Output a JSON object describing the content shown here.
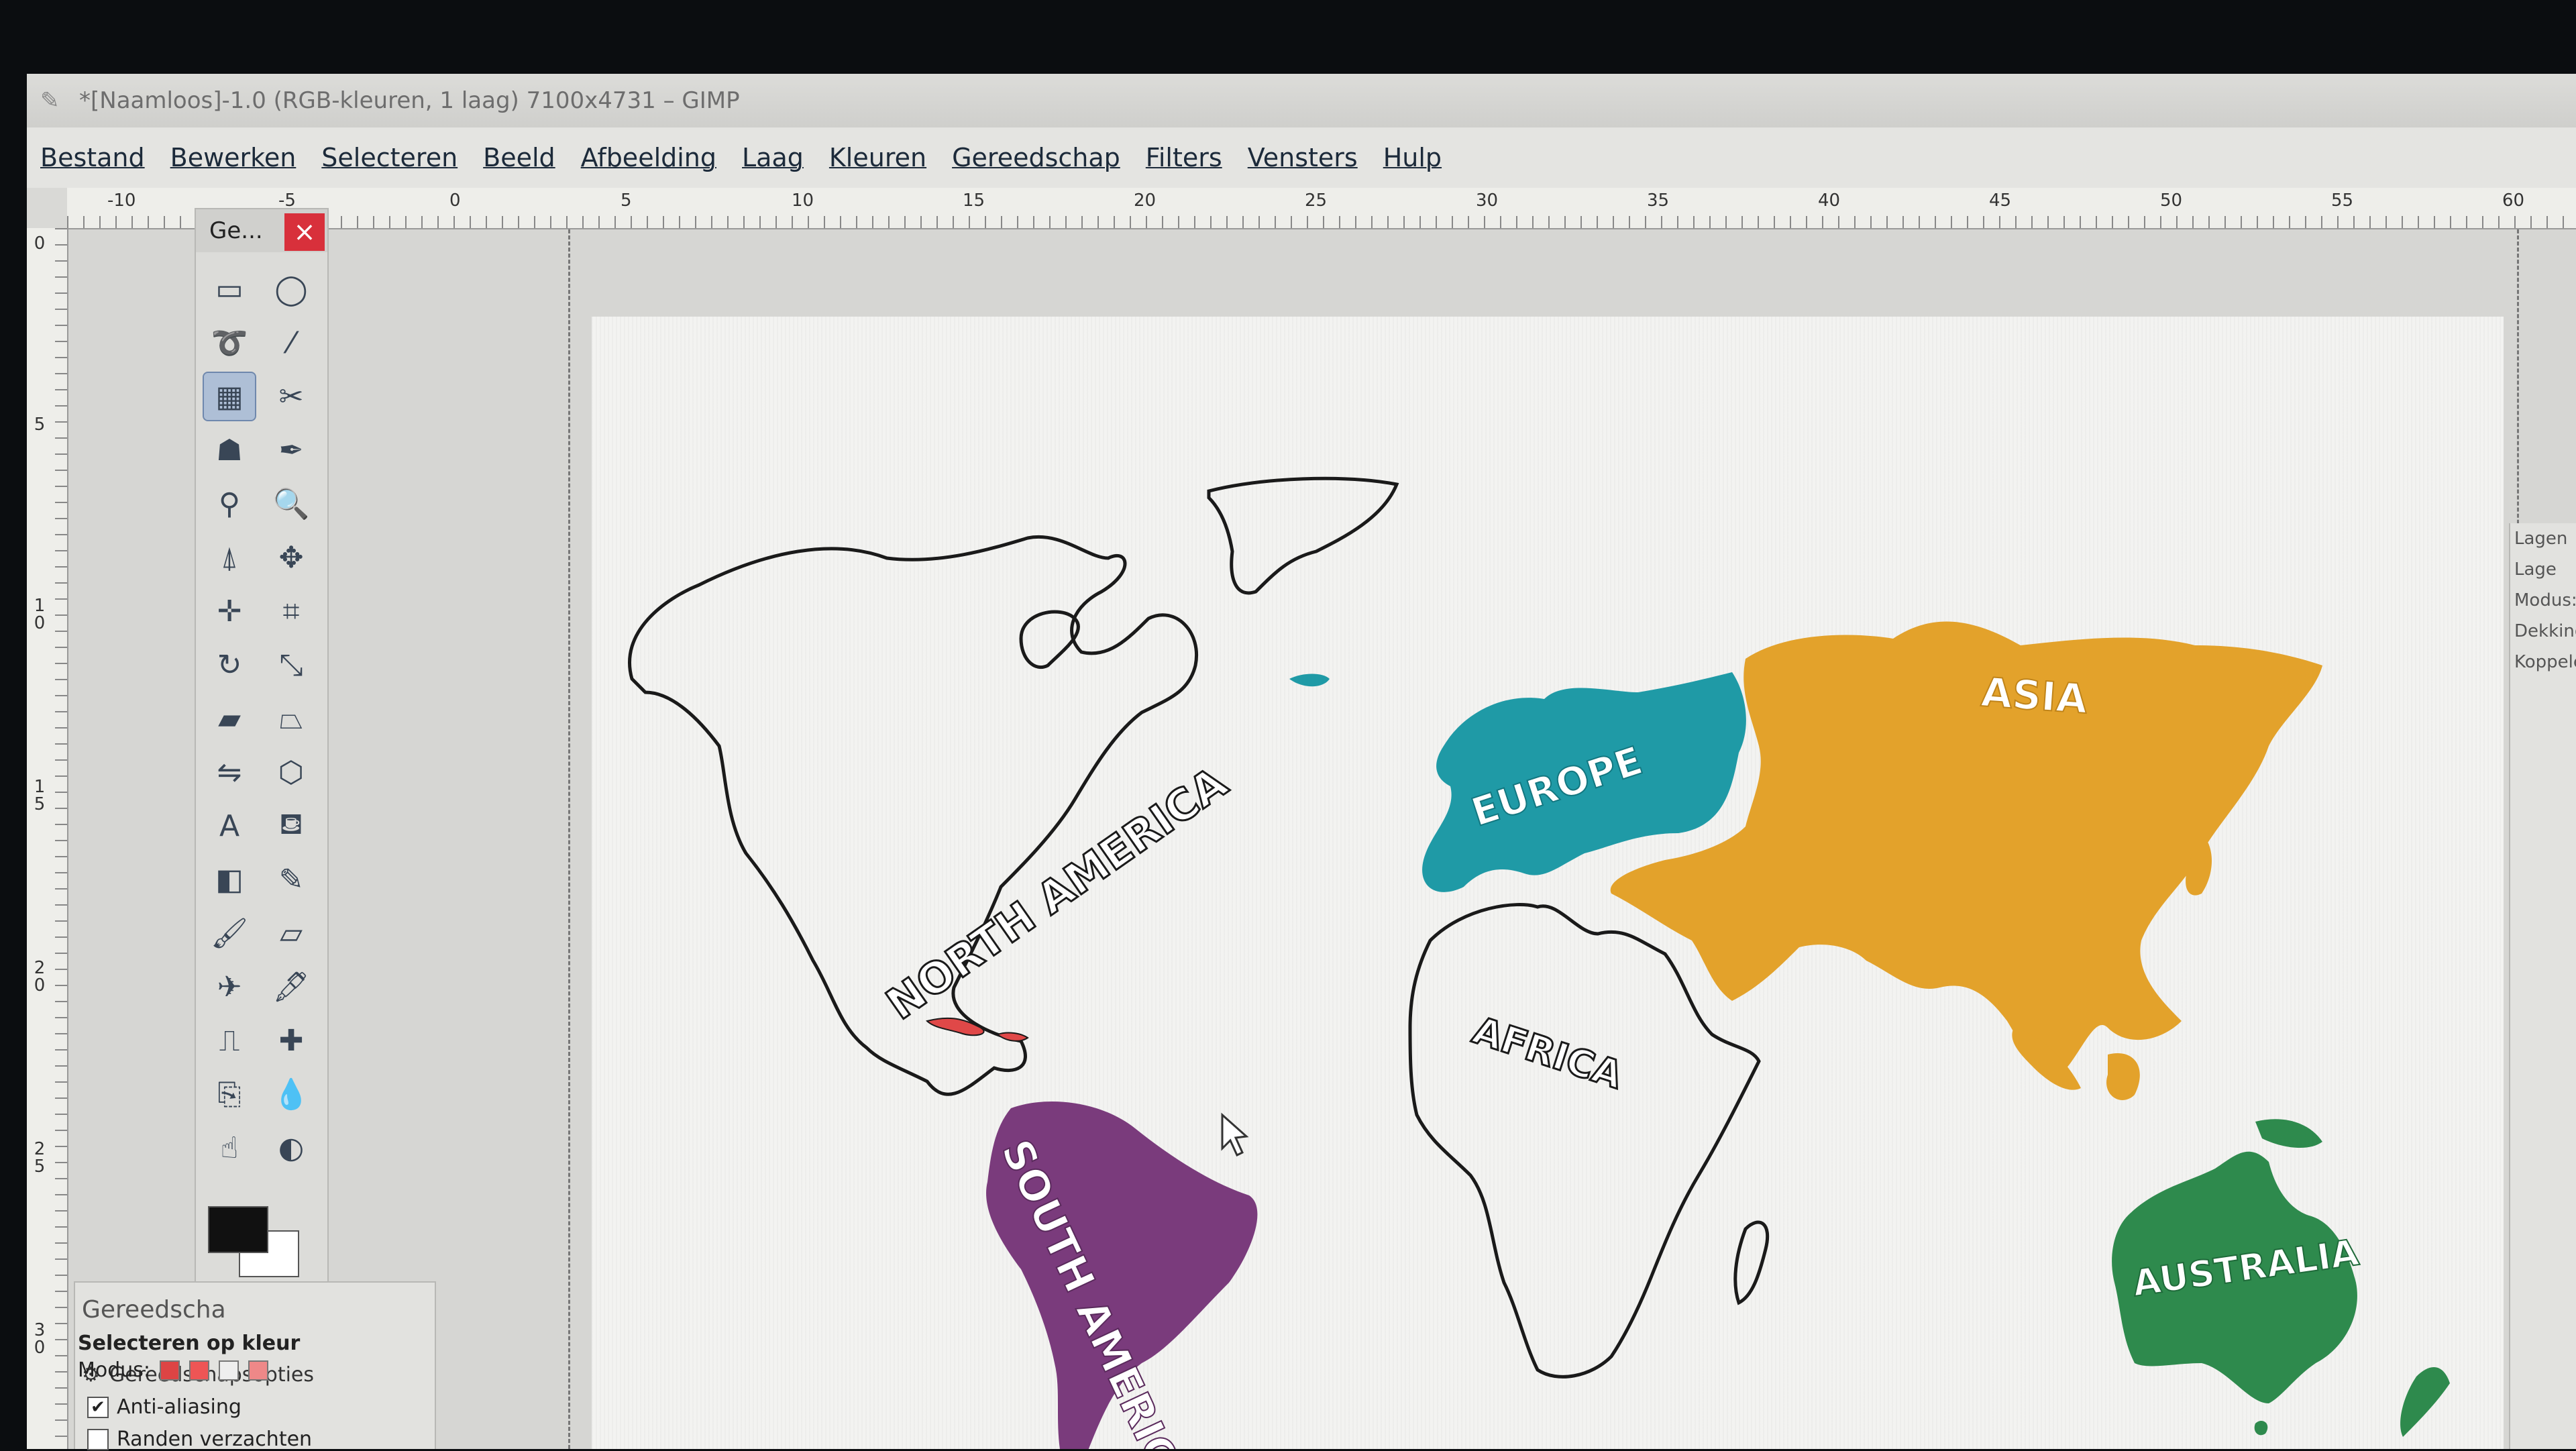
{
  "window": {
    "title": "*[Naamloos]-1.0 (RGB-kleuren, 1 laag) 7100x4731 – GIMP"
  },
  "menubar": {
    "items": [
      "Bestand",
      "Bewerken",
      "Selecteren",
      "Beeld",
      "Afbeelding",
      "Laag",
      "Kleuren",
      "Gereedschap",
      "Filters",
      "Vensters",
      "Hulp"
    ]
  },
  "ruler_top": [
    "-10",
    "-5",
    "0",
    "5",
    "10",
    "15",
    "20",
    "25",
    "30",
    "35",
    "40",
    "45",
    "50",
    "55",
    "60"
  ],
  "ruler_left": [
    "0",
    "5",
    "1\n0",
    "1\n5",
    "2\n0",
    "2\n5",
    "3\n0"
  ],
  "toolbox": {
    "title": "Ge...",
    "close_label": "×",
    "tools": [
      {
        "name": "rect-select-tool-icon",
        "glyph": "▭",
        "active": false
      },
      {
        "name": "ellipse-select-tool-icon",
        "glyph": "◯",
        "active": false
      },
      {
        "name": "free-select-tool-icon",
        "glyph": "➰",
        "active": false
      },
      {
        "name": "fuzzy-select-tool-icon",
        "glyph": "⁄",
        "active": false
      },
      {
        "name": "select-by-color-tool-icon",
        "glyph": "▦",
        "active": true
      },
      {
        "name": "scissors-select-tool-icon",
        "glyph": "✂",
        "active": false
      },
      {
        "name": "foreground-select-tool-icon",
        "glyph": "☗",
        "active": false
      },
      {
        "name": "paths-tool-icon",
        "glyph": "✒",
        "active": false
      },
      {
        "name": "color-picker-tool-icon",
        "glyph": "⚲",
        "active": false
      },
      {
        "name": "zoom-tool-icon",
        "glyph": "🔍",
        "active": false
      },
      {
        "name": "measure-tool-icon",
        "glyph": "⍋",
        "active": false
      },
      {
        "name": "move-tool-icon",
        "glyph": "✥",
        "active": false
      },
      {
        "name": "align-tool-icon",
        "glyph": "✛",
        "active": false
      },
      {
        "name": "crop-tool-icon",
        "glyph": "⌗",
        "active": false
      },
      {
        "name": "rotate-tool-icon",
        "glyph": "↻",
        "active": false
      },
      {
        "name": "scale-tool-icon",
        "glyph": "⤡",
        "active": false
      },
      {
        "name": "shear-tool-icon",
        "glyph": "▰",
        "active": false
      },
      {
        "name": "perspective-tool-icon",
        "glyph": "⏢",
        "active": false
      },
      {
        "name": "flip-tool-icon",
        "glyph": "⇋",
        "active": false
      },
      {
        "name": "cage-transform-tool-icon",
        "glyph": "⬡",
        "active": false
      },
      {
        "name": "text-tool-icon",
        "glyph": "A",
        "active": false
      },
      {
        "name": "bucket-fill-tool-icon",
        "glyph": "⛾",
        "active": false
      },
      {
        "name": "gradient-tool-icon",
        "glyph": "◧",
        "active": false
      },
      {
        "name": "pencil-tool-icon",
        "glyph": "✎",
        "active": false
      },
      {
        "name": "paintbrush-tool-icon",
        "glyph": "🖌",
        "active": false
      },
      {
        "name": "eraser-tool-icon",
        "glyph": "▱",
        "active": false
      },
      {
        "name": "airbrush-tool-icon",
        "glyph": "✈",
        "active": false
      },
      {
        "name": "ink-tool-icon",
        "glyph": "🖋",
        "active": false
      },
      {
        "name": "clone-tool-icon",
        "glyph": "⎍",
        "active": false
      },
      {
        "name": "heal-tool-icon",
        "glyph": "✚",
        "active": false
      },
      {
        "name": "perspective-clone-tool-icon",
        "glyph": "⎘",
        "active": false
      },
      {
        "name": "blur-tool-icon",
        "glyph": "💧",
        "active": false
      },
      {
        "name": "smudge-tool-icon",
        "glyph": "☝",
        "active": false
      },
      {
        "name": "dodge-burn-tool-icon",
        "glyph": "◐",
        "active": false
      }
    ]
  },
  "tool_options": {
    "tab_label": "Gereedscha",
    "header_label": "Gereedschapsopties",
    "title": "Selecteren op kleur",
    "mode_label": "Modus:",
    "antialias_label": "Anti-aliasing",
    "feather_label": "Randen verzachten"
  },
  "right_dock": {
    "items": [
      "Lagen",
      "Lage",
      "Modus:",
      "Dekking",
      "Koppelen"
    ]
  },
  "map": {
    "labels": {
      "north_america": "NORTH AMERICA",
      "south_america": "SOUTH AMERICA",
      "europe": "EUROPE",
      "africa": "AFRICA",
      "asia": "ASIA",
      "australia": "AUSTRALIA"
    },
    "colors": {
      "south_america": "#7a3b7c",
      "europe": "#1f9aa6",
      "asia": "#e3a22b",
      "australia": "#2e8a4d",
      "caribbean": "#e04848",
      "outline": "#1a1a1a",
      "canvas": "#f3f3f1"
    }
  }
}
